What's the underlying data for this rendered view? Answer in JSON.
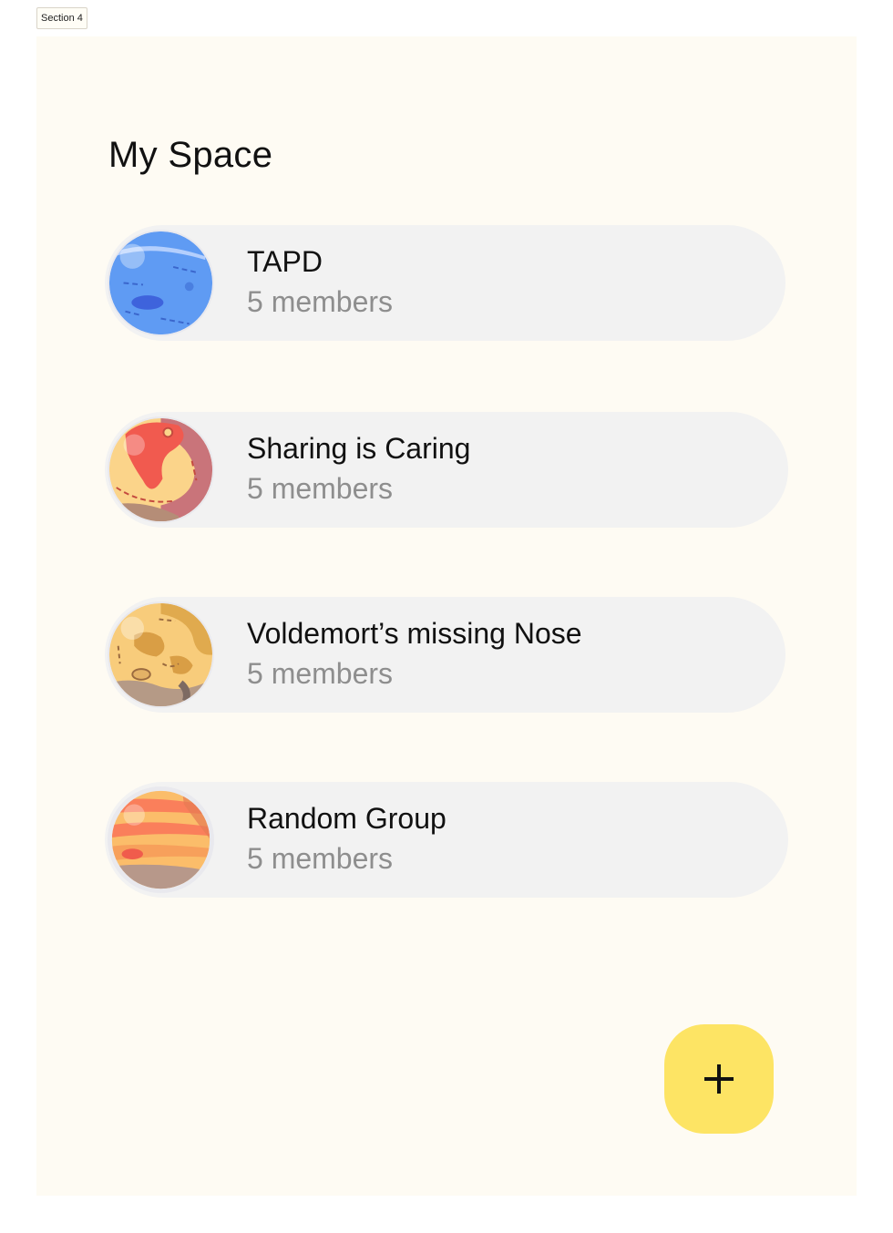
{
  "section_label": "Section 4",
  "page": {
    "title": "My Space",
    "background_color": "#fefbf3"
  },
  "groups": [
    {
      "name": "TAPD",
      "members": "5 members",
      "avatar_icon": "blue-planet-icon",
      "planet_color": "#5f9bf3"
    },
    {
      "name": "Sharing is Caring",
      "members": "5 members",
      "avatar_icon": "red-planet-icon",
      "planet_color": "#f15a4f"
    },
    {
      "name": "Voldemort’s missing Nose",
      "members": "5 members",
      "avatar_icon": "cratered-planet-icon",
      "planet_color": "#f6c26d"
    },
    {
      "name": "Random Group",
      "members": "5 members",
      "avatar_icon": "striped-planet-icon",
      "planet_color": "#fa7f5b"
    }
  ],
  "fab": {
    "icon": "plus-icon",
    "color": "#fde464"
  }
}
